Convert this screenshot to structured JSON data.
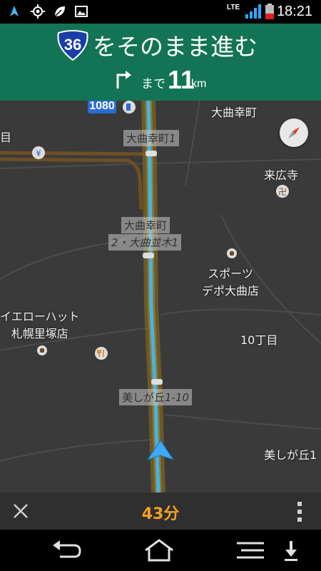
{
  "status_bar": {
    "time": "18:21",
    "network": "LTE",
    "icons": [
      "navigation-arrow-icon",
      "gps-icon",
      "leaf-icon",
      "image-icon",
      "signal-icon",
      "battery-icon"
    ]
  },
  "banner": {
    "route_number": "36",
    "instruction": "をそのまま進む",
    "distance_prefix": "まで",
    "distance_value": "11",
    "distance_unit": "km",
    "color": "#137355"
  },
  "map": {
    "labels": {
      "daimagari_kocho_top": "大曲幸町",
      "raikoji": "来広寺",
      "sports_depot": "スポーツ\nデポ大曲店",
      "tenth_chome": "10丁目",
      "yellow_hat": "イエローハット\n札幌里塚店",
      "utsukushigaoka_right": "美しが丘1",
      "edge_left": "目"
    },
    "road_tags": {
      "kocho1_a": "大曲幸町",
      "kocho1_b": "1",
      "kocho2_a": "大曲幸町",
      "kocho2_b": "2・大曲並木1",
      "utsukushigaoka_a": "美しが丘",
      "utsukushigaoka_b": "1-10"
    },
    "shield": "1080",
    "colors": {
      "background": "#3a3a3a",
      "route": "#3fb5ec",
      "route_outline": "#c9a02b",
      "road_brown": "#6e4f24"
    }
  },
  "bottom_bar": {
    "eta": "43分",
    "eta_color": "#f5a021"
  },
  "system_nav": [
    "back-icon",
    "home-icon",
    "menu-icon",
    "download-icon"
  ]
}
